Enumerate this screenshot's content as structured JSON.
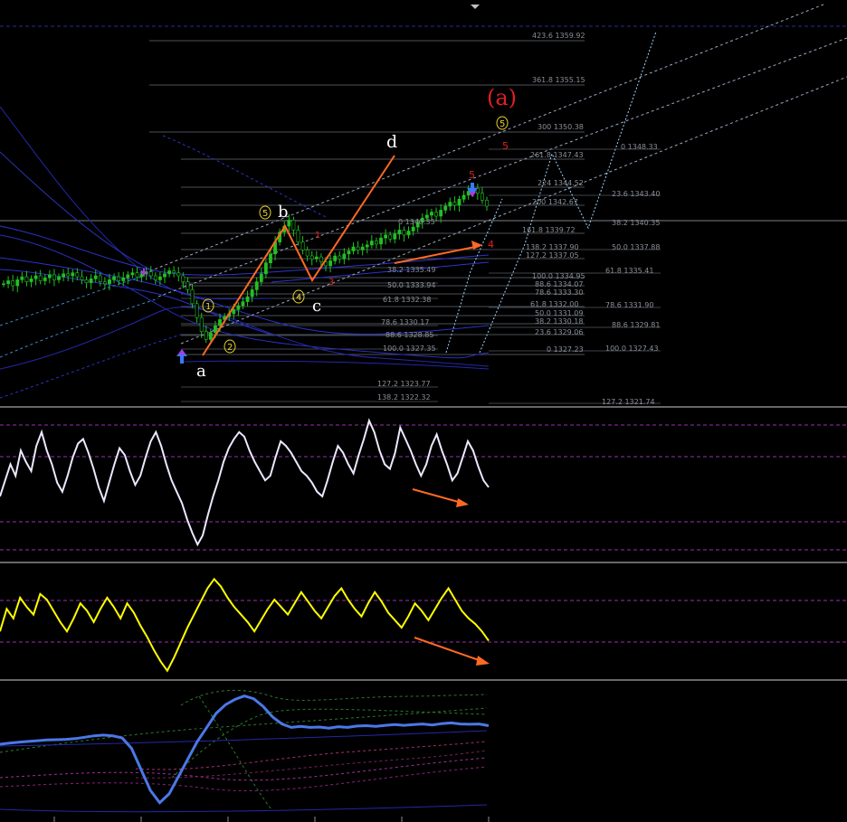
{
  "colors": {
    "background": "#000000",
    "candle_up": "#22c022",
    "candle_down": "#22c022",
    "fib_line": "#5a5f66",
    "fib_text": "#8a8f96",
    "channel": "#2a33c8",
    "channel_dash": "#3d86c8",
    "projection": "#9fd4ff",
    "orange": "#ff6a22",
    "red": "#e02020",
    "yellow": "#e8d22a",
    "white": "#ffffff",
    "panel_divider": "#cfcfcf",
    "level_purple": "#9a2fb0",
    "rsi_white": "#ece8ff",
    "rsi_yellow": "#ffff00",
    "blue_line": "#4b78e8",
    "marker_magenta": "#b03ae0",
    "arrow_blue": "#3a78ff"
  },
  "fib_labels": [
    {
      "text": "423.6 1359.92"
    },
    {
      "text": "361.8 1355.15"
    },
    {
      "text": "300 1350.38"
    },
    {
      "text": "261.8 1347.43"
    },
    {
      "text": "224 1344.52"
    },
    {
      "text": "200 1342.67"
    },
    {
      "text": "161.8 1339.72"
    },
    {
      "text": "138.2 1337.90"
    },
    {
      "text": "127.2 1337.05"
    },
    {
      "text": "100.0 1334.95"
    },
    {
      "text": "88.6 1334.07"
    },
    {
      "text": "78.6 1333.30"
    },
    {
      "text": "61.8 1332.00"
    },
    {
      "text": "50.0 1331.09"
    },
    {
      "text": "38.2 1330.18"
    },
    {
      "text": "23.6 1329.06"
    },
    {
      "text": "0 1327.23"
    },
    {
      "text": "0 1340.35"
    },
    {
      "text": "38.2 1335.49"
    },
    {
      "text": "50.0 1333.94"
    },
    {
      "text": "61.8 1332.38"
    },
    {
      "text": "78.6 1330.17"
    },
    {
      "text": "88.6 1328.85"
    },
    {
      "text": "100.0 1327.35"
    },
    {
      "text": "127.2 1323.77"
    },
    {
      "text": "138.2 1322.32"
    },
    {
      "text": "0 1348.33"
    },
    {
      "text": "23.6 1343.40"
    },
    {
      "text": "38.2 1340.35"
    },
    {
      "text": "50.0 1337.88"
    },
    {
      "text": "61.8 1335.41"
    },
    {
      "text": "78.6 1331.90"
    },
    {
      "text": "88.6 1329.81"
    },
    {
      "text": "100.0 1327.43"
    },
    {
      "text": "127.2 1321.74"
    }
  ],
  "wave_labels": {
    "a_big": "(a)",
    "a": "a",
    "b": "b",
    "c": "c",
    "d": "d",
    "w1": "1",
    "w2": "2",
    "w3": "3",
    "w4": "4",
    "w5": "5",
    "w5_top": "5",
    "red1": "1",
    "red3": "3",
    "red5": "5",
    "red4": "4",
    "red5_top": "5"
  },
  "chart_data": [
    {
      "type": "candlestick",
      "title": "",
      "ylim": [
        1321.0,
        1361.0
      ],
      "closes": [
        1333.2,
        1333.5,
        1333.0,
        1333.6,
        1333.9,
        1333.4,
        1333.7,
        1334.0,
        1333.5,
        1333.8,
        1334.1,
        1333.6,
        1333.9,
        1334.2,
        1334.0,
        1334.3,
        1333.9,
        1333.6,
        1333.3,
        1333.7,
        1334.0,
        1333.4,
        1333.2,
        1333.6,
        1333.9,
        1333.5,
        1333.8,
        1334.1,
        1334.3,
        1333.9,
        1334.2,
        1334.4,
        1334.0,
        1333.6,
        1333.9,
        1334.2,
        1334.5,
        1334.3,
        1334.0,
        1333.4,
        1332.6,
        1331.2,
        1329.8,
        1328.4,
        1327.6,
        1328.3,
        1329.0,
        1329.6,
        1329.9,
        1330.2,
        1330.6,
        1331.0,
        1331.4,
        1331.9,
        1332.6,
        1333.4,
        1334.2,
        1335.3,
        1336.2,
        1337.4,
        1338.4,
        1339.0,
        1339.6,
        1338.6,
        1337.4,
        1336.6,
        1336.0,
        1335.7,
        1335.9,
        1335.4,
        1335.0,
        1335.5,
        1336.0,
        1335.7,
        1336.2,
        1336.5,
        1336.9,
        1336.6,
        1336.9,
        1337.1,
        1337.5,
        1337.2,
        1337.8,
        1338.1,
        1337.7,
        1338.2,
        1338.6,
        1338.1,
        1338.5,
        1338.9,
        1339.4,
        1339.8,
        1340.1,
        1340.4,
        1340.0,
        1340.6,
        1341.0,
        1341.4,
        1341.1,
        1341.7,
        1342.1,
        1342.5,
        1342.8,
        1342.3,
        1341.6,
        1341.0
      ],
      "fib_levels": [
        "423.6 1359.92",
        "361.8 1355.15",
        "300 1350.38",
        "261.8 1347.43",
        "224 1344.52",
        "200 1342.67",
        "161.8 1339.72",
        "138.2 1337.90",
        "127.2 1337.05",
        "100.0 1334.95",
        "88.6 1334.07",
        "78.6 1333.30",
        "61.8 1332.00",
        "50.0 1331.09",
        "38.2 1330.18",
        "23.6 1329.06",
        "0 1327.23"
      ]
    },
    {
      "type": "line",
      "series": [
        {
          "values": [
            38,
            45,
            52,
            47,
            58,
            53,
            49,
            60,
            66,
            58,
            52,
            44,
            40,
            47,
            55,
            61,
            63,
            57,
            50,
            42,
            36,
            44,
            52,
            59,
            56,
            49,
            43,
            47,
            55,
            62,
            66,
            60,
            52,
            45,
            40,
            35,
            28,
            22,
            17,
            21,
            30,
            38,
            45,
            53,
            59,
            63,
            66,
            64,
            58,
            53,
            49,
            45,
            47,
            55,
            62,
            60,
            57,
            53,
            49,
            47,
            44,
            40,
            38,
            45,
            53,
            60,
            57,
            52,
            48,
            56,
            63,
            71,
            66,
            58,
            52,
            50,
            57,
            68,
            63,
            58,
            52,
            47,
            52,
            60,
            65,
            58,
            52,
            45,
            48,
            55,
            62,
            58,
            51,
            45,
            42
          ]
        }
      ]
    },
    {
      "type": "line",
      "series": [
        {
          "values": [
            40,
            52,
            47,
            58,
            53,
            49,
            60,
            57,
            51,
            45,
            40,
            47,
            55,
            51,
            45,
            52,
            58,
            53,
            47,
            55,
            50,
            43,
            37,
            30,
            24,
            19,
            26,
            34,
            42,
            49,
            56,
            63,
            68,
            64,
            58,
            53,
            49,
            45,
            40,
            46,
            52,
            57,
            53,
            49,
            55,
            61,
            56,
            51,
            47,
            53,
            59,
            63,
            57,
            52,
            48,
            55,
            61,
            56,
            50,
            46,
            42,
            48,
            55,
            51,
            46,
            52,
            58,
            63,
            57,
            51,
            47,
            44,
            40,
            35
          ]
        }
      ]
    },
    {
      "type": "line",
      "series": [
        {
          "values": [
            31.2,
            31.5,
            31.8,
            32.0,
            32.2,
            32.4,
            32.5,
            32.6,
            32.8,
            33.2,
            33.6,
            33.8,
            33.6,
            33.0,
            30.0,
            24.0,
            18.0,
            14.5,
            17.0,
            22.0,
            27.0,
            32.0,
            36.0,
            40.0,
            42.5,
            44.0,
            45.0,
            44.2,
            42.0,
            39.0,
            37.0,
            36.0,
            36.3,
            36.0,
            36.1,
            35.8,
            36.2,
            36.0,
            36.4,
            36.5,
            36.3,
            36.6,
            36.8,
            36.6,
            36.8,
            37.0,
            36.7,
            37.1,
            37.3,
            37.0,
            36.9,
            37.0,
            36.5
          ]
        }
      ]
    }
  ]
}
